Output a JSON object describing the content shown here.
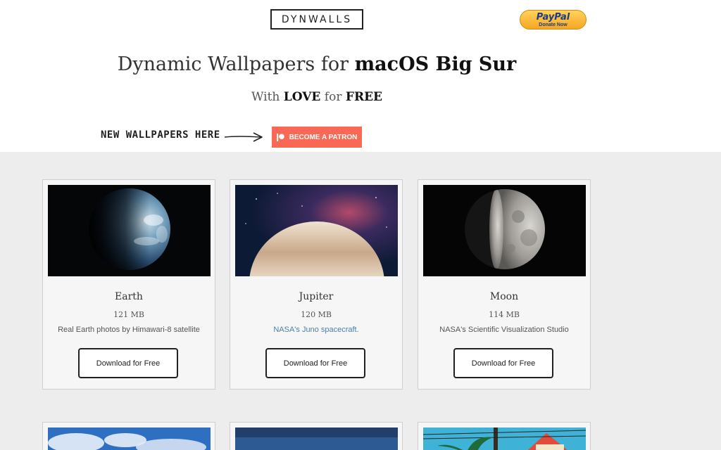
{
  "header": {
    "logo": "DYNWALLS",
    "paypal": {
      "word": "PayPal",
      "sub": "Donate Now"
    },
    "headline_prefix": "Dynamic Wallpapers for ",
    "headline_bold": "macOS Big Sur",
    "subline_prefix": "With ",
    "subline_love": "LOVE",
    "subline_mid": " for ",
    "subline_free": "FREE",
    "new_note": "NEW WALLPAPERS HERE",
    "patron_label": "BECOME A PATRON"
  },
  "colors": {
    "accent_patreon": "#f96854",
    "paypal_gold": "#f5a623",
    "link_blue": "#4e7fa6",
    "page_bg": "#ededed"
  },
  "cards": [
    {
      "name": "Earth",
      "size": "121 MB",
      "credit": "Real Earth photos by Himawari-8 satellite",
      "button": "Download for Free"
    },
    {
      "name": "Jupiter",
      "size": "120 MB",
      "credit": "NASA's Juno spacecraft.",
      "button": "Download for Free"
    },
    {
      "name": "Moon",
      "size": "114 MB",
      "credit": "NASA's Scientific Visualization Studio",
      "button": "Download for Free"
    }
  ]
}
